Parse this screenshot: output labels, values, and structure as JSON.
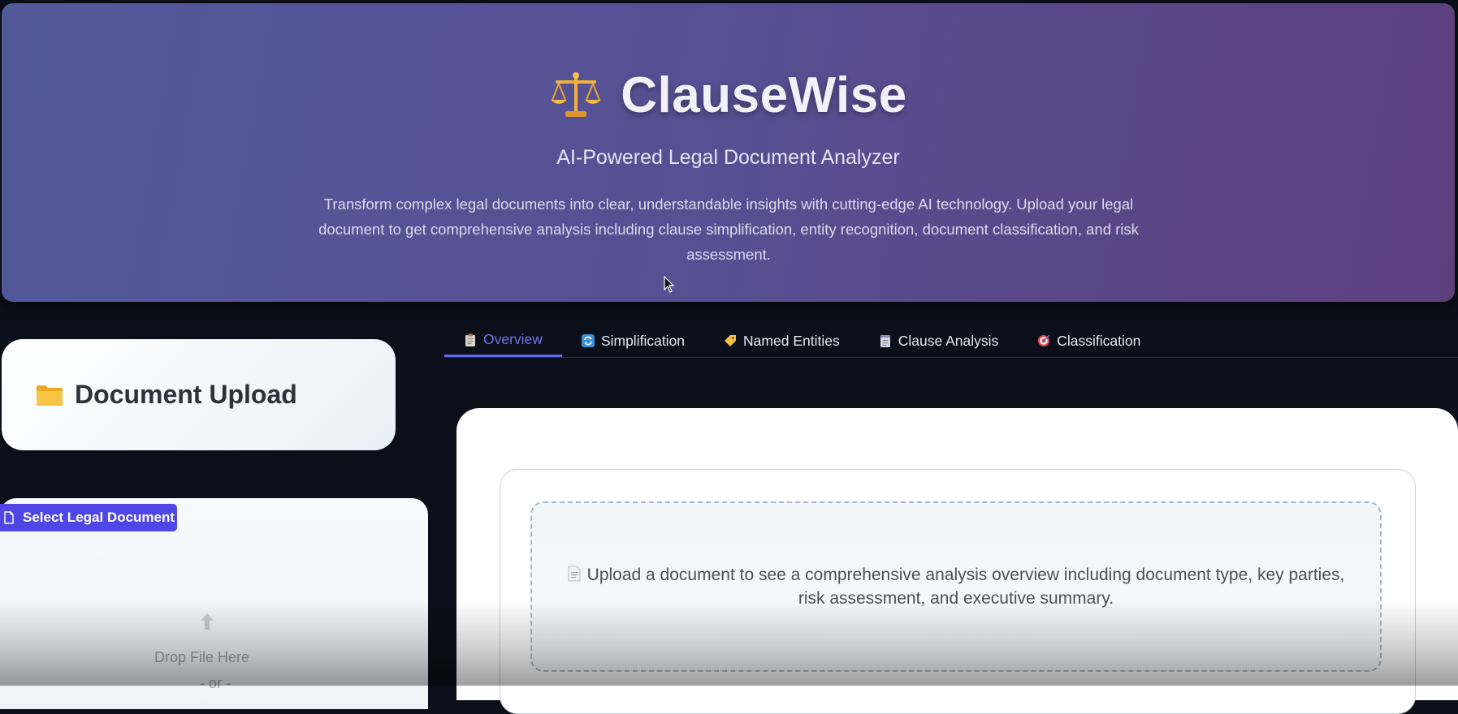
{
  "header": {
    "title": "ClauseWise",
    "logo_icon": "balance-scale-icon",
    "subtitle": "AI-Powered Legal Document Analyzer",
    "description": "Transform complex legal documents into clear, understandable insights with cutting-edge AI technology. Upload your legal document to get comprehensive analysis including clause simplification, entity recognition, document classification, and risk assessment."
  },
  "tabs": [
    {
      "label": "Overview",
      "icon": "clipboard-icon",
      "active": true
    },
    {
      "label": "Simplification",
      "icon": "refresh-icon",
      "active": false
    },
    {
      "label": "Named Entities",
      "icon": "tag-icon",
      "active": false
    },
    {
      "label": "Clause Analysis",
      "icon": "notepad-icon",
      "active": false
    },
    {
      "label": "Classification",
      "icon": "target-icon",
      "active": false
    }
  ],
  "sidebar": {
    "upload_title": "Document Upload",
    "upload_icon": "folder-icon",
    "select_button": "Select Legal Document",
    "select_icon": "file-icon",
    "drop_text": "Drop File Here",
    "drop_or": "- or -"
  },
  "main": {
    "placeholder": "Upload a document to see a comprehensive analysis overview including document type, key parties, risk assessment, and executive summary.",
    "placeholder_icon": "document-icon"
  },
  "colors": {
    "accent": "#4f46e5",
    "active_tab": "#6f73ea",
    "hero_start": "#51599a",
    "hero_end": "#5d3f7e",
    "background": "#0b0f19"
  }
}
